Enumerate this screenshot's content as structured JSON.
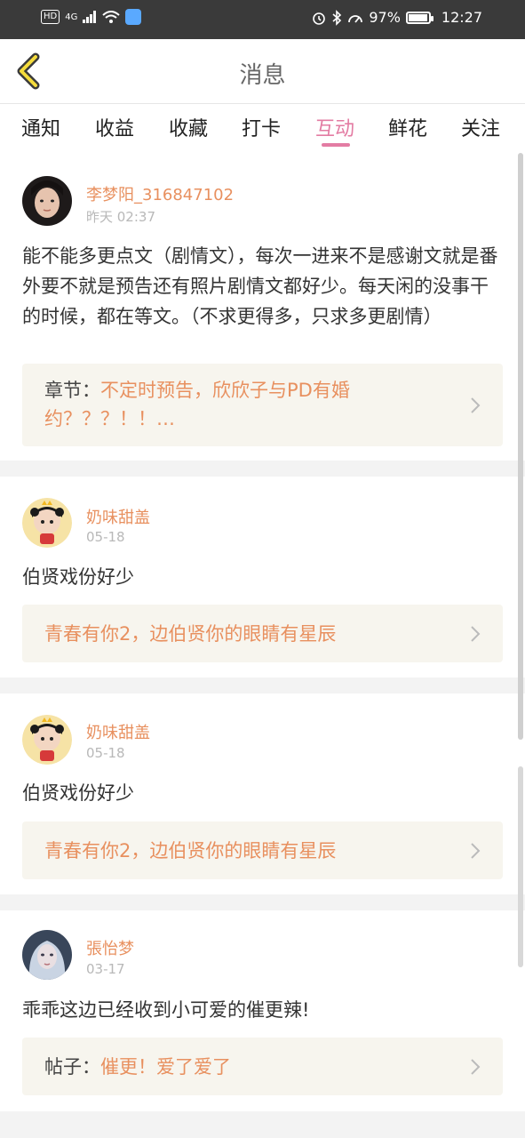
{
  "status_bar": {
    "hd": "HD",
    "net": "4G",
    "battery_pct": "97%",
    "time": "12:27",
    "battery_level": 0.97
  },
  "header": {
    "title": "消息"
  },
  "tabs": [
    {
      "label": "通知"
    },
    {
      "label": "收益"
    },
    {
      "label": "收藏"
    },
    {
      "label": "打卡"
    },
    {
      "label": "互动",
      "active": true
    },
    {
      "label": "鲜花"
    },
    {
      "label": "关注"
    }
  ],
  "messages": [
    {
      "user": "李梦阳_316847102",
      "time": "昨天 02:37",
      "text": "能不能多更点文（剧情文），每次一进来不是感谢文就是番外要不就是预告还有照片剧情文都好少。每天闲的没事干的时候，都在等文。（不求更得多，只求多更剧情）",
      "ref_prefix": "章节：",
      "ref_text": "不定时预告，欣欣子与PD有婚约？？？！！…"
    },
    {
      "user": "奶味甜盖",
      "time": "05-18",
      "text": "伯贤戏份好少",
      "ref_prefix": "",
      "ref_text": "青春有你2，边伯贤你的眼睛有星辰"
    },
    {
      "user": "奶味甜盖",
      "time": "05-18",
      "text": "伯贤戏份好少",
      "ref_prefix": "",
      "ref_text": "青春有你2，边伯贤你的眼睛有星辰"
    },
    {
      "user": "張怡梦",
      "time": "03-17",
      "text": "乖乖这边已经收到小可爱的催更辣!",
      "ref_prefix": "帖子：",
      "ref_text": "催更！爱了爱了"
    }
  ],
  "colors": {
    "accent_pink": "#e37ca3",
    "username_orange": "#e8905f",
    "ref_bg": "#f7f5ee"
  }
}
